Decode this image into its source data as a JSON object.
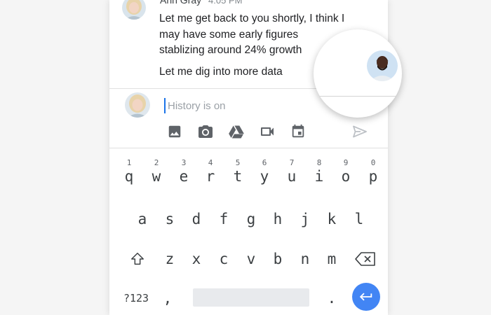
{
  "message": {
    "sender": "Ann Gray",
    "time": "4:05 PM",
    "line1": "Let me get back to you shortly, I think I",
    "line2": "may have some early figures",
    "line3": "stablizing around 24% growth",
    "line4": "Let me dig into more data"
  },
  "compose": {
    "placeholder": "History is on"
  },
  "toolbar": {
    "icons": [
      "image-icon",
      "camera-icon",
      "drive-icon",
      "video-icon",
      "calendar-icon",
      "send-icon"
    ]
  },
  "keyboard": {
    "row1_numbers": [
      "1",
      "2",
      "3",
      "4",
      "5",
      "6",
      "7",
      "8",
      "9",
      "0"
    ],
    "row1_letters": [
      "q",
      "w",
      "e",
      "r",
      "t",
      "y",
      "u",
      "i",
      "o",
      "p"
    ],
    "row2": [
      "a",
      "s",
      "d",
      "f",
      "g",
      "h",
      "j",
      "k",
      "l"
    ],
    "row3": [
      "z",
      "x",
      "c",
      "v",
      "b",
      "n",
      "m"
    ],
    "symbols_label": "?123",
    "comma": ",",
    "period": "."
  },
  "colors": {
    "accent": "#4285f4",
    "cursor": "#1a73e8",
    "icon": "#5f6368",
    "send_disabled": "#bdc1c6"
  }
}
